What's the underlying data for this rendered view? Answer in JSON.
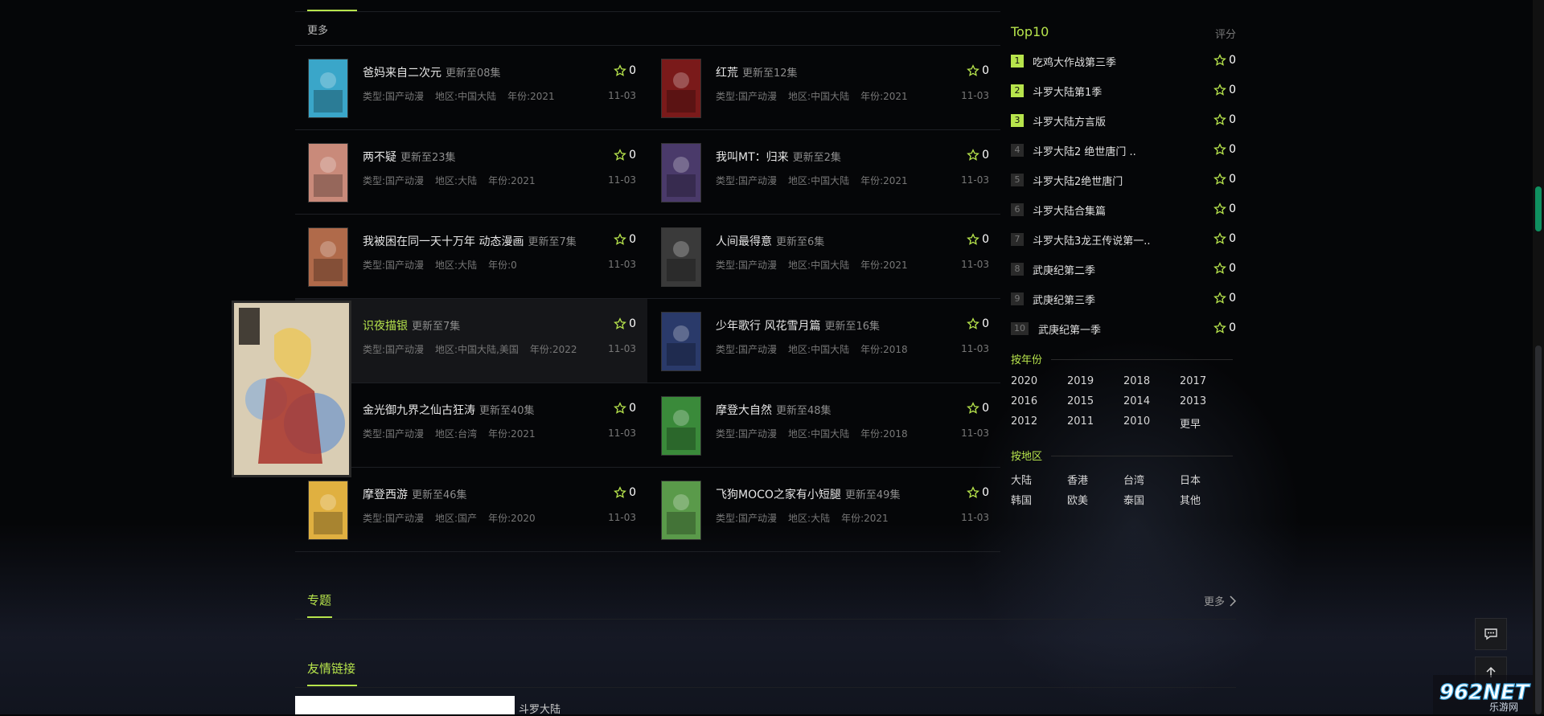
{
  "main": {
    "more_label": "更多",
    "items": [
      {
        "title": "爸妈来自二次元",
        "update": "更新至08集",
        "type": "类型:国产动漫",
        "region": "地区:中国大陆",
        "year": "年份:2021",
        "score": "0",
        "date": "11-03",
        "color": "#3aa6c9"
      },
      {
        "title": "红荒",
        "update": "更新至12集",
        "type": "类型:国产动漫",
        "region": "地区:中国大陆",
        "year": "年份:2021",
        "score": "0",
        "date": "11-03",
        "color": "#7a1a1a"
      },
      {
        "title": "两不疑",
        "update": "更新至23集",
        "type": "类型:国产动漫",
        "region": "地区:大陆",
        "year": "年份:2021",
        "score": "0",
        "date": "11-03",
        "color": "#c98a7a"
      },
      {
        "title": "我叫MT：归来",
        "update": "更新至2集",
        "type": "类型:国产动漫",
        "region": "地区:中国大陆",
        "year": "年份:2021",
        "score": "0",
        "date": "11-03",
        "color": "#4a3a6a"
      },
      {
        "title": "我被困在同一天十万年 动态漫画",
        "update": "更新至7集",
        "type": "类型:国产动漫",
        "region": "地区:大陆",
        "year": "年份:0",
        "score": "0",
        "date": "11-03",
        "color": "#b06a4a"
      },
      {
        "title": "人间最得意",
        "update": "更新至6集",
        "type": "类型:国产动漫",
        "region": "地区:中国大陆",
        "year": "年份:2021",
        "score": "0",
        "date": "11-03",
        "color": "#3a3a3a"
      },
      {
        "title": "识夜描银",
        "update": "更新至7集",
        "type": "类型:国产动漫",
        "region": "地区:中国大陆,美国",
        "year": "年份:2022",
        "score": "0",
        "date": "11-03",
        "color": "#c9b08a"
      },
      {
        "title": "少年歌行 风花雪月篇",
        "update": "更新至16集",
        "type": "类型:国产动漫",
        "region": "地区:中国大陆",
        "year": "年份:2018",
        "score": "0",
        "date": "11-03",
        "color": "#2a3a6a"
      },
      {
        "title": "金光御九界之仙古狂涛",
        "update": "更新至40集",
        "type": "类型:国产动漫",
        "region": "地区:台湾",
        "year": "年份:2021",
        "score": "0",
        "date": "11-03",
        "color": "#5a4a3a"
      },
      {
        "title": "摩登大自然",
        "update": "更新至48集",
        "type": "类型:国产动漫",
        "region": "地区:中国大陆",
        "year": "年份:2018",
        "score": "0",
        "date": "11-03",
        "color": "#3a8a3a"
      },
      {
        "title": "摩登西游",
        "update": "更新至46集",
        "type": "类型:国产动漫",
        "region": "地区:国产",
        "year": "年份:2020",
        "score": "0",
        "date": "11-03",
        "color": "#e0b040"
      },
      {
        "title": "飞狗MOCO之家有小短腿",
        "update": "更新至49集",
        "type": "类型:国产动漫",
        "region": "地区:大陆",
        "year": "年份:2021",
        "score": "0",
        "date": "11-03",
        "color": "#5a9a4a"
      }
    ]
  },
  "sidebar": {
    "title": "Top10",
    "rate_label": "评分",
    "ranks": [
      {
        "num": "1",
        "name": "吃鸡大作战第三季",
        "score": "0"
      },
      {
        "num": "2",
        "name": "斗罗大陆第1季",
        "score": "0"
      },
      {
        "num": "3",
        "name": "斗罗大陆方言版",
        "score": "0"
      },
      {
        "num": "4",
        "name": "斗罗大陆2 绝世唐门 ..",
        "score": "0"
      },
      {
        "num": "5",
        "name": "斗罗大陆2绝世唐门",
        "score": "0"
      },
      {
        "num": "6",
        "name": "斗罗大陆合集篇",
        "score": "0"
      },
      {
        "num": "7",
        "name": "斗罗大陆3龙王传说第一..",
        "score": "0"
      },
      {
        "num": "8",
        "name": "武庚纪第二季",
        "score": "0"
      },
      {
        "num": "9",
        "name": "武庚纪第三季",
        "score": "0"
      },
      {
        "num": "10",
        "name": "武庚纪第一季",
        "score": "0"
      }
    ],
    "year_title": "按年份",
    "years": [
      "2020",
      "2019",
      "2018",
      "2017",
      "2016",
      "2015",
      "2014",
      "2013",
      "2012",
      "2011",
      "2010",
      "更早"
    ],
    "region_title": "按地区",
    "regions": [
      "大陆",
      "香港",
      "台湾",
      "日本",
      "韩国",
      "欧美",
      "泰国",
      "其他"
    ]
  },
  "footer": {
    "topic_title": "专题",
    "topic_more": "更多",
    "friend_title": "友情链接",
    "friend_link": "斗罗大陆"
  },
  "colors": {
    "accent": "#b7e44c",
    "background": "#050608"
  },
  "icons": {
    "star": "star-icon",
    "comment": "comment-icon",
    "back_top": "arrow-up-icon",
    "chevron": "chevron-right-icon"
  },
  "watermark": {
    "logo_text": "962NET",
    "sub_text": "乐游网"
  }
}
